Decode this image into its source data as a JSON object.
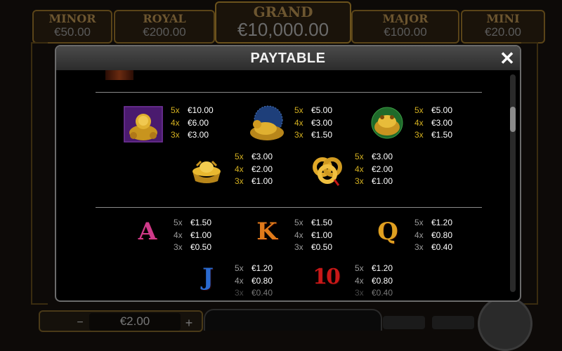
{
  "jackpots": {
    "minor": {
      "name": "MINOR",
      "value": "€50.00"
    },
    "royal": {
      "name": "ROYAL",
      "value": "€200.00"
    },
    "grand": {
      "name": "GRAND",
      "value": "€10,000.00"
    },
    "major": {
      "name": "MAJOR",
      "value": "€100.00"
    },
    "mini": {
      "name": "MINI",
      "value": "€20.00"
    }
  },
  "bet": {
    "value": "€2.00",
    "minus": "−",
    "plus": "+"
  },
  "modal": {
    "title": "PAYTABLE",
    "close": "✕"
  },
  "paytable": {
    "high_row1": [
      {
        "icon": "buddha-icon",
        "pays": [
          [
            "5x",
            "€10.00"
          ],
          [
            "4x",
            "€6.00"
          ],
          [
            "3x",
            "€3.00"
          ]
        ]
      },
      {
        "icon": "golden-dragon-turtle-icon",
        "pays": [
          [
            "5x",
            "€5.00"
          ],
          [
            "4x",
            "€3.00"
          ],
          [
            "3x",
            "€1.50"
          ]
        ]
      },
      {
        "icon": "golden-toad-icon",
        "pays": [
          [
            "5x",
            "€5.00"
          ],
          [
            "4x",
            "€3.00"
          ],
          [
            "3x",
            "€1.50"
          ]
        ]
      }
    ],
    "high_row2": [
      {
        "icon": "gold-ingot-icon",
        "pays": [
          [
            "5x",
            "€3.00"
          ],
          [
            "4x",
            "€2.00"
          ],
          [
            "3x",
            "€1.00"
          ]
        ]
      },
      {
        "icon": "lucky-knot-icon",
        "pays": [
          [
            "5x",
            "€3.00"
          ],
          [
            "4x",
            "€2.00"
          ],
          [
            "3x",
            "€1.00"
          ]
        ]
      }
    ],
    "low_row1": [
      {
        "icon": "letter-a-icon",
        "glyph": "A",
        "pays": [
          [
            "5x",
            "€1.50"
          ],
          [
            "4x",
            "€1.00"
          ],
          [
            "3x",
            "€0.50"
          ]
        ]
      },
      {
        "icon": "letter-k-icon",
        "glyph": "K",
        "pays": [
          [
            "5x",
            "€1.50"
          ],
          [
            "4x",
            "€1.00"
          ],
          [
            "3x",
            "€0.50"
          ]
        ]
      },
      {
        "icon": "letter-q-icon",
        "glyph": "Q",
        "pays": [
          [
            "5x",
            "€1.20"
          ],
          [
            "4x",
            "€0.80"
          ],
          [
            "3x",
            "€0.40"
          ]
        ]
      }
    ],
    "low_row2": [
      {
        "icon": "letter-j-icon",
        "glyph": "J",
        "pays": [
          [
            "5x",
            "€1.20"
          ],
          [
            "4x",
            "€0.80"
          ],
          [
            "3x",
            "€0.40"
          ]
        ]
      },
      {
        "icon": "number-10-icon",
        "glyph": "10",
        "pays": [
          [
            "5x",
            "€1.20"
          ],
          [
            "4x",
            "€0.80"
          ],
          [
            "3x",
            "€0.40"
          ]
        ]
      }
    ]
  },
  "colors": {
    "multiplier_gold": "#d4b020",
    "multiplier_grey": "#9a9a9a",
    "letter_a": "#d03a8a",
    "letter_k": "#e07a1a",
    "letter_q": "#e0a020",
    "letter_j": "#2a6ad0",
    "number_10": "#c81818"
  }
}
